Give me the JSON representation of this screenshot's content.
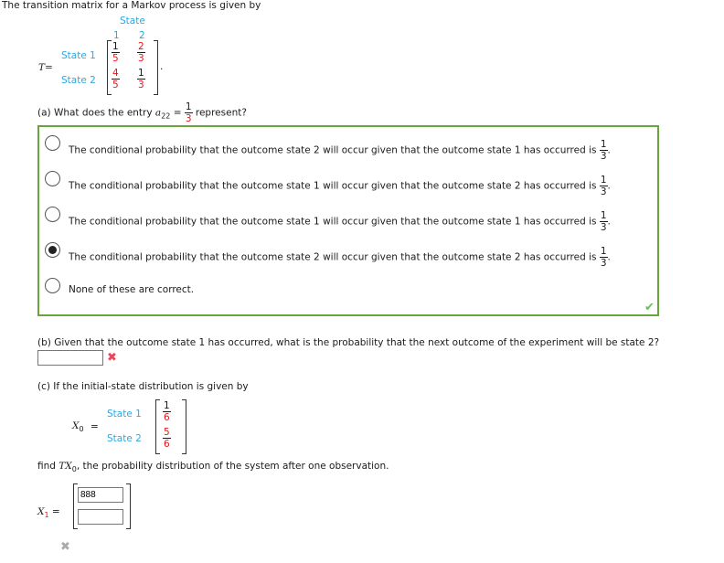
{
  "intro": "The transition matrix for a Markov process is given by",
  "matrix": {
    "header": "State",
    "col_labels": [
      "1",
      "2"
    ],
    "row_labels": [
      "State 1",
      "State 2"
    ],
    "symbol": "T=",
    "entries": [
      [
        {
          "num": "1",
          "den": "5",
          "num_color": "#1a1a1a",
          "den_color": "#e8141b"
        },
        {
          "num": "2",
          "den": "3",
          "num_color": "#e8141b",
          "den_color": "#e8141b"
        }
      ],
      [
        {
          "num": "4",
          "den": "5",
          "num_color": "#e8141b",
          "den_color": "#e8141b"
        },
        {
          "num": "1",
          "den": "3",
          "num_color": "#1a1a1a",
          "den_color": "#e8141b"
        }
      ]
    ],
    "trailing": "."
  },
  "part_a": {
    "question_prefix": "(a) What does the entry ",
    "entry_symbol": "a",
    "entry_sub": "22",
    "equals": " = ",
    "frac_num": "1",
    "frac_den": "3",
    "question_suffix": " represent?",
    "options": [
      {
        "label": "The conditional probability that the outcome state 2 will occur given that the outcome state 1 has occurred is",
        "frac_num": "1",
        "frac_den": "3",
        "selected": false
      },
      {
        "label": "The conditional probability that the outcome state 1 will occur given that the outcome state 2 has occurred is",
        "frac_num": "1",
        "frac_den": "3",
        "selected": false
      },
      {
        "label": "The conditional probability that the outcome state 1 will occur given that the outcome state 1 has occurred is",
        "frac_num": "1",
        "frac_den": "3",
        "selected": false
      },
      {
        "label": "The conditional probability that the outcome state 2 will occur given that the outcome state 2 has occurred is",
        "frac_num": "1",
        "frac_den": "3",
        "selected": true
      },
      {
        "label": "None of these are correct.",
        "selected": false
      }
    ],
    "status": "correct",
    "status_icon": "✔",
    "border_color": "#6aa53a"
  },
  "part_b": {
    "question": "(b) Given that the outcome state 1 has occurred, what is the probability that the next outcome of the experiment will be state 2?",
    "answer_value": "",
    "status": "incorrect",
    "status_icon": "✖"
  },
  "part_c": {
    "question": "(c) If the initial-state distribution is given by",
    "x0_symbol": "X",
    "x0_sub": "0",
    "equals": "=",
    "row_labels": [
      "State 1",
      "State 2"
    ],
    "entries": [
      {
        "num": "1",
        "den": "6"
      },
      {
        "num": "5",
        "den": "6"
      }
    ],
    "find_prefix": "find ",
    "find_symbol": "TX",
    "find_sub": "0",
    "find_suffix": ", the probability distribution of the system after one observation.",
    "x1_symbol": "X",
    "x1_sub": "1",
    "x1_equals": "=",
    "answers": [
      "888",
      ""
    ],
    "status_icon": "✖"
  }
}
